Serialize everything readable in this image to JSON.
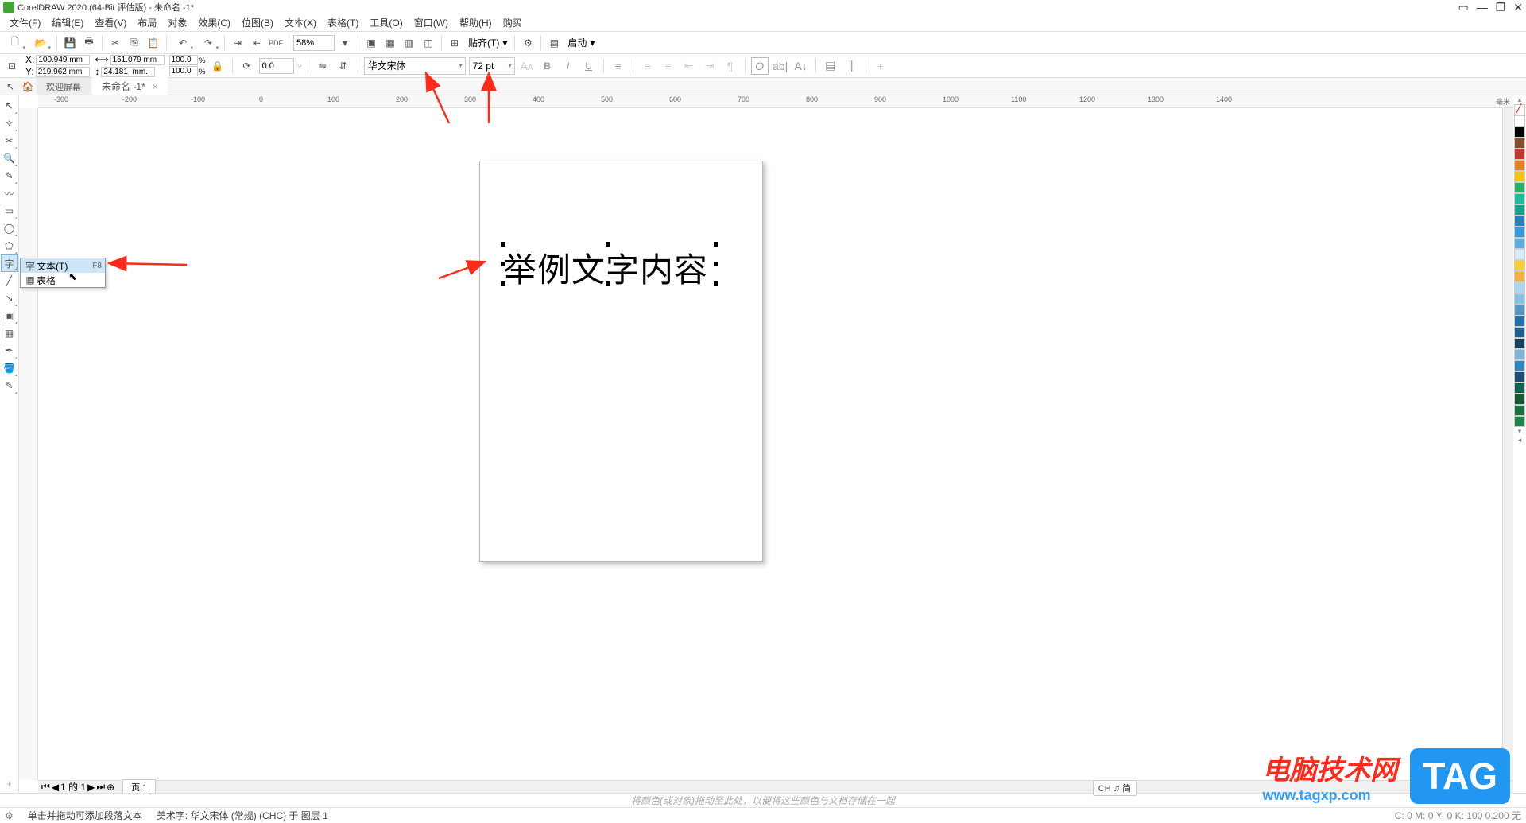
{
  "title": "CorelDRAW 2020 (64-Bit 评估版) - 未命名 -1*",
  "menu": [
    "文件(F)",
    "编辑(E)",
    "查看(V)",
    "布局",
    "对象",
    "效果(C)",
    "位图(B)",
    "文本(X)",
    "表格(T)",
    "工具(O)",
    "窗口(W)",
    "帮助(H)",
    "购买"
  ],
  "toolbar1": {
    "zoom": "58%",
    "align_label": "贴齐(T)",
    "launch": "启动"
  },
  "props": {
    "x": "100.949 mm",
    "y": "219.962 mm",
    "w": "151.079 mm",
    "h": "24.181  mm.",
    "sx": "100.0",
    "sy": "100.0",
    "rot": "0.0",
    "font": "华文宋体",
    "size": "72 pt"
  },
  "tabs": {
    "welcome": "欢迎屏幕",
    "doc": "未命名 -1*"
  },
  "ruler_ticks": [
    "-300",
    "-200",
    "-100",
    "0",
    "100",
    "200",
    "300",
    "400",
    "500",
    "600",
    "700",
    "800",
    "900",
    "1000",
    "1100",
    "1200",
    "1300",
    "1400"
  ],
  "ruler_unit": "毫米",
  "canvas_text": "举例文字内容",
  "flyout": {
    "text": "文本(T)",
    "text_sc": "F8",
    "table": "表格"
  },
  "palette_colors": [
    "#ffffff",
    "#000000",
    "#8b4a2b",
    "#c0392b",
    "#e67e22",
    "#f1c40f",
    "#27ae60",
    "#1abc9c",
    "#16a085",
    "#2980b9",
    "#3498db",
    "#5dade2",
    "#d6eaf8",
    "#f4d03f",
    "#f5b041",
    "#aed6f1",
    "#85c1e9",
    "#5499c7",
    "#2471a3",
    "#1f618d",
    "#154360",
    "#7fb3d5",
    "#2e86c1",
    "#1b4f72",
    "#0e6251",
    "#145a32",
    "#196f3d",
    "#1e8449"
  ],
  "page_nav": {
    "pos": "1 的 1",
    "page_tab": "页 1"
  },
  "hint": "将颜色(或对象)拖动至此处，以便将这些颜色与文档存储在一起",
  "lang": "CH ♫ 简",
  "status": {
    "hint": "单击并拖动可添加段落文本",
    "obj": "美术字:  华文宋体 (常规) (CHC) 于 图层 1",
    "color_info": "C: 0  M: 0  Y: 0  K: 100  0.200 无"
  },
  "watermark": {
    "t1": "电脑技术网",
    "t2": "www.tagxp.com",
    "tag": "TAG"
  }
}
